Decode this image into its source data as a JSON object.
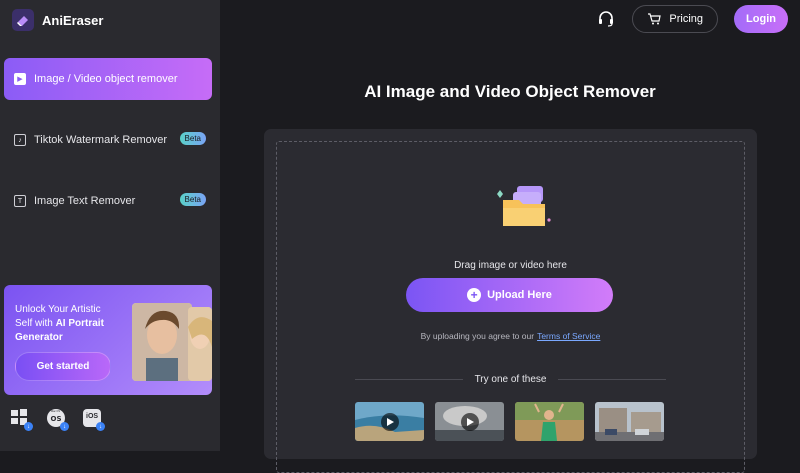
{
  "app": {
    "name": "AniEraser"
  },
  "header": {
    "pricing_label": "Pricing",
    "login_label": "Login"
  },
  "sidebar": {
    "items": [
      {
        "label": "Image / Video object remover",
        "active": true
      },
      {
        "label": "Tiktok Watermark Remover",
        "badge": "Beta"
      },
      {
        "label": "Image Text Remover",
        "badge": "Beta"
      }
    ],
    "promo": {
      "line1": "Unlock Your Artistic",
      "line2_prefix": "Self with ",
      "line2_bold": "AI Portrait",
      "line3_bold": "Generator",
      "button": "Get started"
    },
    "os_labels": {
      "mac": "Mac OS",
      "ios": "iOS"
    }
  },
  "main": {
    "title": "AI Image and Video Object Remover",
    "drag_text": "Drag image or video here",
    "upload_label": "Upload Here",
    "agree_text": "By uploading you agree to our",
    "terms_link": "Terms of Service",
    "try_text": "Try one of these"
  },
  "colors": {
    "accent": "#8b5cf6",
    "accent2": "#c66cf7",
    "background": "#1b1b1f",
    "sidebar": "#2a2a2f"
  }
}
